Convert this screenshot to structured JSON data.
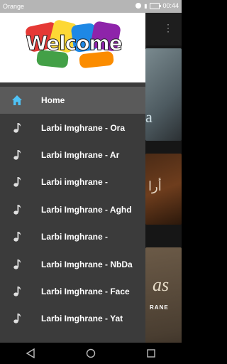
{
  "status_bar": {
    "carrier": "Orange",
    "time": "00:44"
  },
  "drawer": {
    "header_logo_text": "Welcome",
    "items": [
      {
        "label": "Home",
        "icon": "home-icon",
        "active": true
      },
      {
        "label": "Larbi Imghrane - Ora",
        "icon": "music-note-icon"
      },
      {
        "label": "Larbi Imghrane - Ar",
        "icon": "music-note-icon"
      },
      {
        "label": "Larbi imghrane -",
        "icon": "music-note-icon"
      },
      {
        "label": "Larbi Imghrane - Aghd",
        "icon": "music-note-icon"
      },
      {
        "label": "Larbi Imghrane -",
        "icon": "music-note-icon"
      },
      {
        "label": "Larbi Imghrane - NbDa",
        "icon": "music-note-icon"
      },
      {
        "label": "Larbi Imghrane - Face",
        "icon": "music-note-icon"
      },
      {
        "label": "Larbi Imghrane - Yat",
        "icon": "music-note-icon"
      }
    ]
  },
  "background": {
    "card1_text": "a",
    "card2_text": "أرا",
    "card3_text": "as",
    "card3_sub": "RANE"
  },
  "colors": {
    "accent": "#4fc3f7",
    "drawer_bg": "#3b3b3b",
    "active_item_bg": "#5a5a5a"
  }
}
